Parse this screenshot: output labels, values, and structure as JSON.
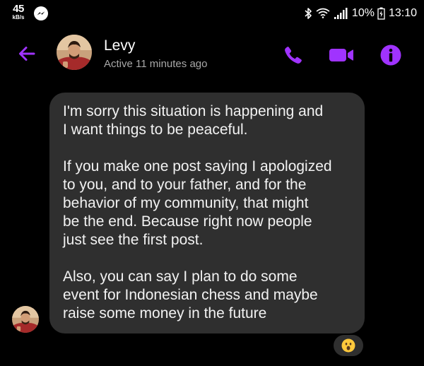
{
  "status_bar": {
    "net_speed": "45",
    "net_speed_unit": "kB/s",
    "battery_percent": "10%",
    "time": "13:10",
    "icons": [
      "messenger-notification-icon",
      "bluetooth-icon",
      "wifi-icon",
      "signal-icon",
      "battery-charging-icon"
    ]
  },
  "header": {
    "contact_name": "Levy",
    "contact_status": "Active 11 minutes ago",
    "icons": [
      "back-arrow-icon",
      "phone-icon",
      "video-camera-icon",
      "info-icon"
    ]
  },
  "colors": {
    "accent": "#a033ff",
    "background": "#000000",
    "bubble": "#2f2f2f",
    "secondary_text": "#a8a8a8"
  },
  "message": {
    "paragraphs": [
      {
        "lines": [
          "I'm sorry this situation is happening and",
          "I want things to be peaceful."
        ]
      },
      {
        "lines": [
          "If you make one post saying I apologized",
          "to you, and to your father, and for the",
          "behavior of my community, that might",
          "be the end. Because right now people",
          "just see the first post."
        ]
      },
      {
        "lines": [
          "Also, you can say I plan to do some",
          "event for Indonesian chess and maybe",
          "raise some money in the future"
        ]
      }
    ],
    "reaction": "astonished-face-emoji"
  }
}
